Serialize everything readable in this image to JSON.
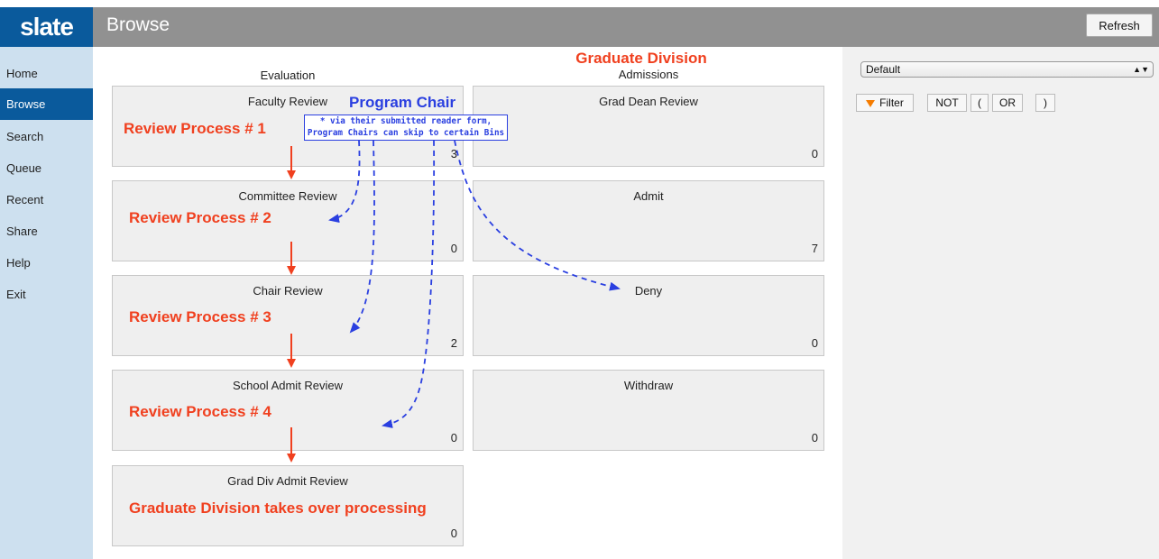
{
  "header": {
    "logo": "slate",
    "title": "Browse",
    "refresh_label": "Refresh"
  },
  "sidebar": {
    "items": [
      {
        "label": "Home"
      },
      {
        "label": "Browse"
      },
      {
        "label": "Search"
      },
      {
        "label": "Queue"
      },
      {
        "label": "Recent"
      },
      {
        "label": "Share"
      },
      {
        "label": "Help"
      },
      {
        "label": "Exit"
      }
    ],
    "active": "Browse"
  },
  "main": {
    "graduate_division_title": "Graduate Division",
    "evaluation_label": "Evaluation",
    "admissions_label": "Admissions",
    "evaluation_bins": [
      {
        "title": "Faculty Review",
        "count": "3"
      },
      {
        "title": "Committee Review",
        "count": "0"
      },
      {
        "title": "Chair Review",
        "count": "2"
      },
      {
        "title": "School Admit Review",
        "count": "0"
      },
      {
        "title": "Grad Div Admit Review",
        "count": "0"
      }
    ],
    "admissions_bins": [
      {
        "title": "Grad Dean Review",
        "count": "0"
      },
      {
        "title": "Admit",
        "count": "7"
      },
      {
        "title": "Deny",
        "count": "0"
      },
      {
        "title": "Withdraw",
        "count": "0"
      }
    ]
  },
  "annotations": {
    "rp1": "Review Process # 1",
    "rp2": "Review Process # 2",
    "rp3": "Review Process # 3",
    "rp4": "Review Process # 4",
    "takeover": "Graduate Division takes over processing",
    "program_chair": "Program Chair",
    "note_line1": "* via their submitted reader form,",
    "note_line2": "Program Chairs can skip to certain Bins",
    "annotation_red": "#f0401f",
    "annotation_blue": "#2a3fe0"
  },
  "rightpanel": {
    "select_value": "Default",
    "filter_label": "Filter",
    "not_label": "NOT",
    "open_paren": "(",
    "or_label": "OR",
    "close_paren": ")"
  },
  "colors": {
    "brand": "#0a5a9c",
    "header": "#919191",
    "sidebar": "#cde0ef",
    "bin": "#efefef"
  }
}
